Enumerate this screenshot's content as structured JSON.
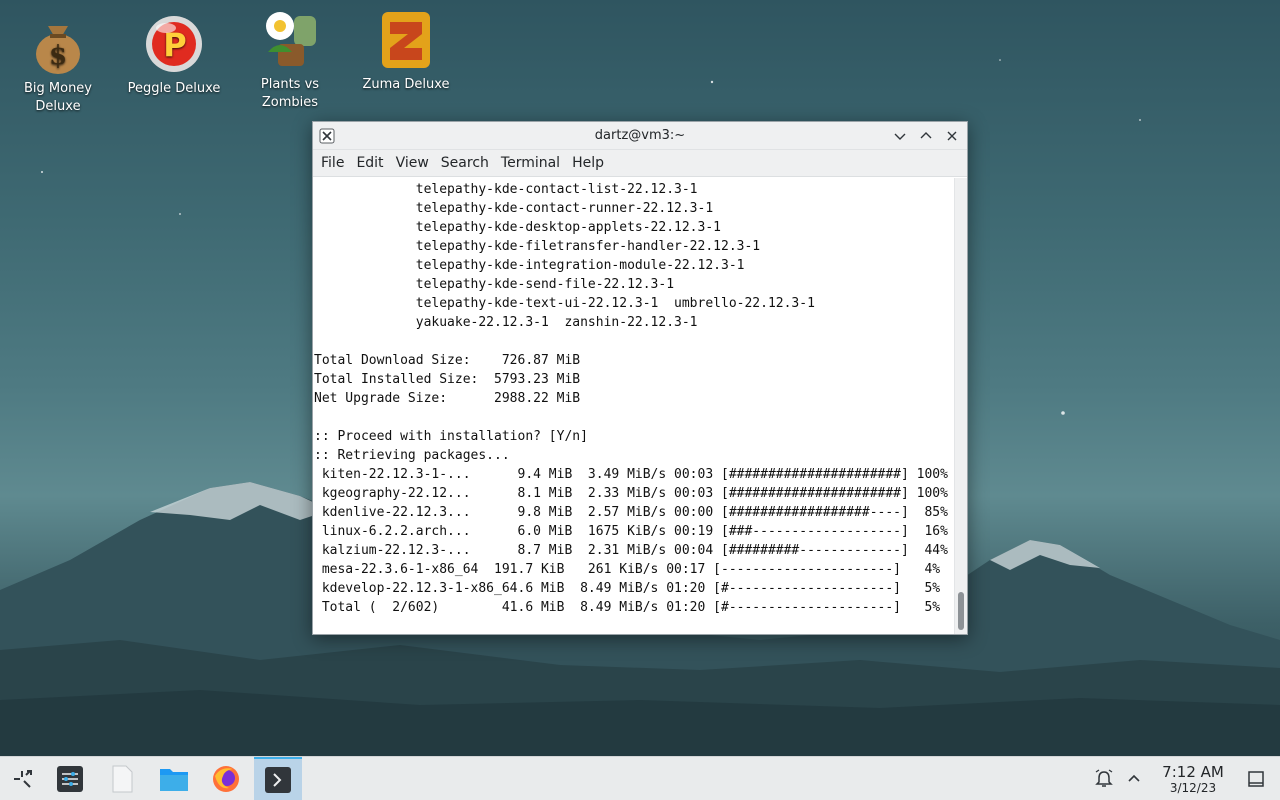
{
  "desktop": {
    "icons": [
      {
        "label": "Big Money Deluxe"
      },
      {
        "label": "Peggle Deluxe"
      },
      {
        "label": "Plants vs Zombies"
      },
      {
        "label": "Zuma Deluxe"
      }
    ]
  },
  "window": {
    "title": "dartz@vm3:~",
    "menu": [
      "File",
      "Edit",
      "View",
      "Search",
      "Terminal",
      "Help"
    ],
    "terminal_lines": [
      "             telepathy-kde-contact-list-22.12.3-1",
      "             telepathy-kde-contact-runner-22.12.3-1",
      "             telepathy-kde-desktop-applets-22.12.3-1",
      "             telepathy-kde-filetransfer-handler-22.12.3-1",
      "             telepathy-kde-integration-module-22.12.3-1",
      "             telepathy-kde-send-file-22.12.3-1",
      "             telepathy-kde-text-ui-22.12.3-1  umbrello-22.12.3-1",
      "             yakuake-22.12.3-1  zanshin-22.12.3-1",
      "",
      "Total Download Size:    726.87 MiB",
      "Total Installed Size:  5793.23 MiB",
      "Net Upgrade Size:      2988.22 MiB",
      "",
      ":: Proceed with installation? [Y/n]",
      ":: Retrieving packages...",
      " kiten-22.12.3-1-...      9.4 MiB  3.49 MiB/s 00:03 [######################] 100%",
      " kgeography-22.12...      8.1 MiB  2.33 MiB/s 00:03 [######################] 100%",
      " kdenlive-22.12.3...      9.8 MiB  2.57 MiB/s 00:00 [##################----]  85%",
      " linux-6.2.2.arch...      6.0 MiB  1675 KiB/s 00:19 [###-------------------]  16%",
      " kalzium-22.12.3-...      8.7 MiB  2.31 MiB/s 00:04 [#########-------------]  44%",
      " mesa-22.3.6-1-x86_64  191.7 KiB   261 KiB/s 00:17 [----------------------]   4%",
      " kdevelop-22.12.3-1-x86_64.6 MiB  8.49 MiB/s 01:20 [#---------------------]   5%",
      " Total (  2/602)        41.6 MiB  8.49 MiB/s 01:20 [#---------------------]   5%"
    ]
  },
  "taskbar": {
    "time": "7:12 AM",
    "date": "3/12/23"
  },
  "colors": {
    "accent": "#3daee9",
    "panel": "#e9ebec",
    "window_chrome": "#eff0f1"
  }
}
